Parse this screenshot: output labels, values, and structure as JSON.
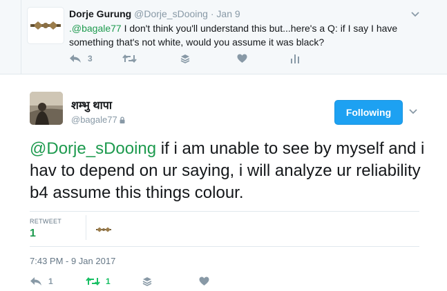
{
  "parent_tweet": {
    "author_name": "Dorje Gurung",
    "author_handle": "@Dorje_sDooing",
    "separator": " · ",
    "date": "Jan 9",
    "mention": ".@bagale77",
    "text": " I don't think you'll understand this but...here's a Q: if I say I have something that's not white, would you assume it was black?",
    "reply_count": "3",
    "retweet_count": "",
    "like_count": ""
  },
  "main_tweet": {
    "author_name": "शम्भु थापा",
    "author_handle": "@bagale77",
    "follow_button_label": "Following",
    "mention": "@Dorje_sDooing",
    "text": " if i am unable to see by myself and i hav to depend on ur saying, i will analyze ur reliability b4 assume this things colour.",
    "stats": {
      "retweets_label": "RETWEET",
      "retweets_value": "1"
    },
    "timestamp": "7:43 PM - 9 Jan 2017",
    "reply_count": "1",
    "retweet_count": "1",
    "like_count": ""
  },
  "colors": {
    "accent_blue": "#1da1f2",
    "mention_green": "#1d9a4e",
    "retweet_green": "#17bf63",
    "muted": "#8899a6"
  },
  "icons": [
    "reply-icon",
    "retweet-icon",
    "stack-icon",
    "heart-icon",
    "analytics-icon",
    "chevron-down-icon",
    "lock-icon"
  ]
}
